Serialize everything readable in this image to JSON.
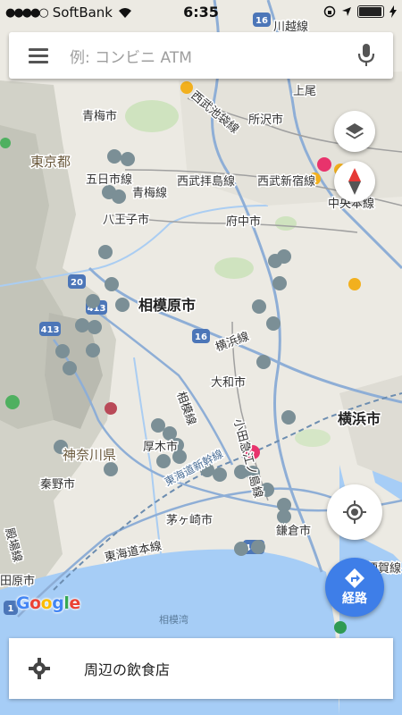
{
  "status_bar": {
    "carrier": "SoftBank",
    "time": "6:35"
  },
  "search": {
    "placeholder": "例: コンビニ ATM"
  },
  "map": {
    "labels": {
      "kawagoe_line": "川越線",
      "ageo": "上尾",
      "seibu_ikebukuro": "西武池袋線",
      "ome_city": "青梅市",
      "tokorozawa_city": "所沢市",
      "tokyo_to": "東京都",
      "itsukaichi_line": "五日市線",
      "seibu_haijima_line": "西武拝島線",
      "seibu_shinjuku_line": "西武新宿線",
      "ome_line": "青梅線",
      "chuo_main_line": "中央本線",
      "hachioji_city": "八王子市",
      "fuchu_city": "府中市",
      "sagamihara_city": "相模原市",
      "yokohama_line": "横浜線",
      "yamato_city": "大和市",
      "yokohama_city": "横浜市",
      "sagami_line": "相模線",
      "odakyu_enoshima_line": "小田急江ノ島線",
      "kanagawa_ken": "神奈川県",
      "atsugi_city": "厚木市",
      "tokaido_shinkansen": "東海道新幹線",
      "hadano_city": "秦野市",
      "chigasaki_city": "茅ヶ崎市",
      "kamakura_city": "鎌倉市",
      "tokaido_main_line": "東海道本線",
      "yokosuka_line": "横須賀線",
      "odawara_city": "田原市",
      "sagami_bay": "相模湾",
      "gotemba_line": "殿場線",
      "route_16a": "16",
      "route_16b": "16",
      "route_20": "20",
      "route_413a": "413",
      "route_413b": "413",
      "route_467": "467",
      "route_1": "1"
    }
  },
  "buttons": {
    "route_label": "経路"
  },
  "google_logo": {
    "G": "G",
    "o1": "o",
    "o2": "o",
    "g": "g",
    "l": "l",
    "e": "e"
  },
  "bottom_card": {
    "label": "周辺の飲食店"
  },
  "colors": {
    "land": "#eceae3",
    "mountain": "#cfd0c7",
    "green": "#c6dfb4",
    "water": "#a6cdf6",
    "highway": "#7ea1cc",
    "rail": "#9a9a9a",
    "accent": "#3e7ee8",
    "pin": "#7b8f96"
  }
}
